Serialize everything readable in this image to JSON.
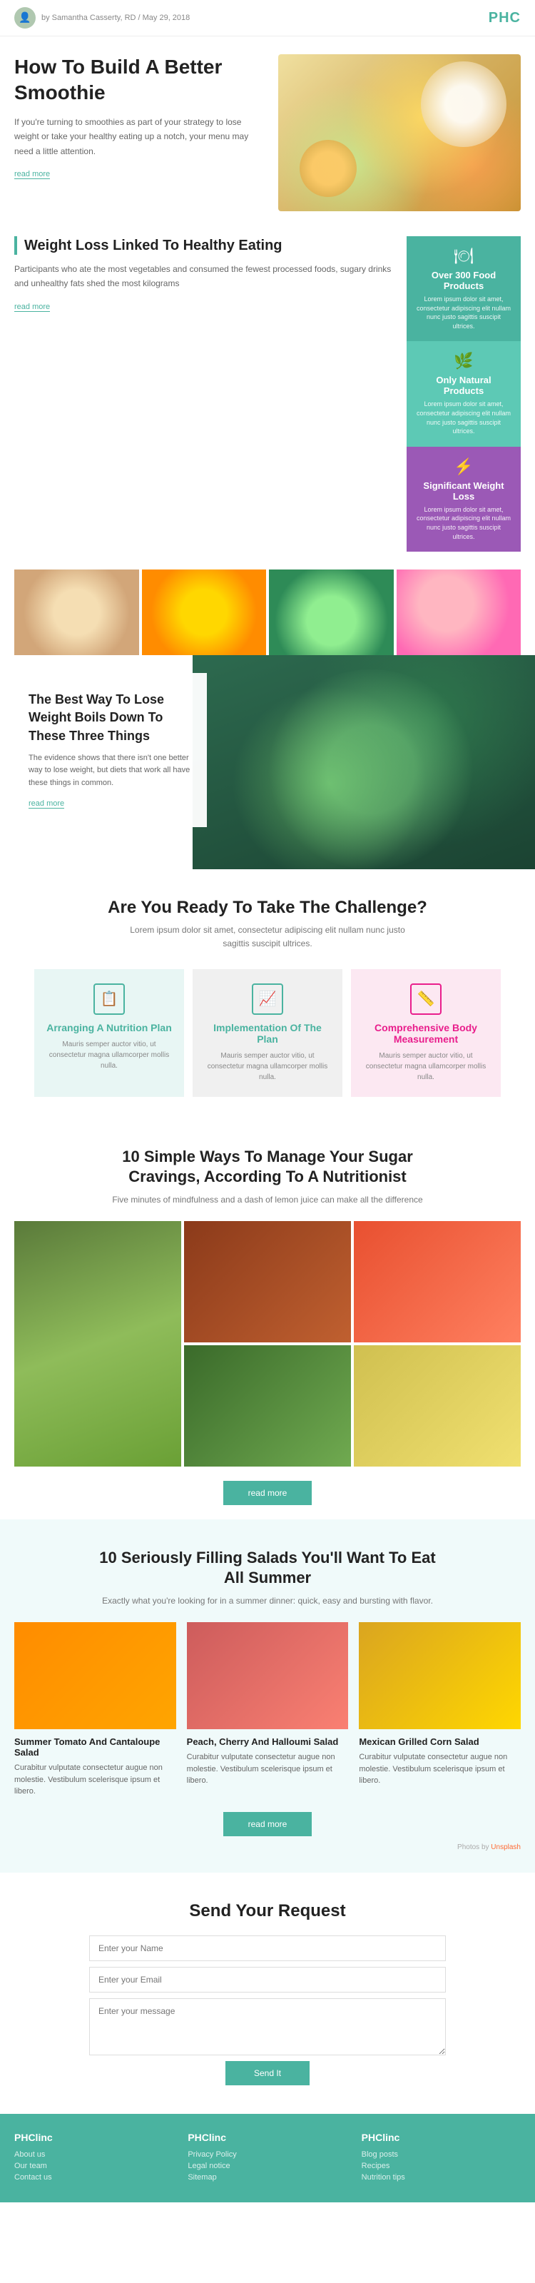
{
  "header": {
    "author": "by Samantha Casserty, RD / May 29, 2018",
    "logo": "PHC"
  },
  "hero": {
    "title": "How To Build A Better Smoothie",
    "description": "If you're turning to smoothies as part of your strategy to lose weight or take your healthy eating up a notch, your menu may need a little attention.",
    "read_more": "read more"
  },
  "weight_section": {
    "title": "Weight Loss Linked To Healthy Eating",
    "description": "Participants who ate the most vegetables and consumed the fewest processed foods, sugary drinks and unhealthy fats shed the most kilograms",
    "read_more": "read more",
    "cards": [
      {
        "icon": "🍽",
        "title": "Over 300 Food Products",
        "text": "Lorem ipsum dolor sit amet, consectetur adipiscing elit nullam nunc justo sagittis suscipit ultrices."
      },
      {
        "icon": "🌿",
        "title": "Only Natural Products",
        "text": "Lorem ipsum dolor sit amet, consectetur adipiscing elit nullam nunc justo sagittis suscipit ultrices."
      },
      {
        "icon": "⚡",
        "title": "Significant Weight Loss",
        "text": "Lorem ipsum dolor sit amet, consectetur adipiscing elit nullam nunc justo sagittis suscipit ultrices."
      }
    ]
  },
  "big_banner": {
    "title": "The Best Way To Lose Weight Boils Down To These Three Things",
    "description": "The evidence shows that there isn't one better way to lose weight, but diets that work all have these things in common.",
    "read_more": "read more"
  },
  "challenge_section": {
    "title": "Are You Ready To Take The Challenge?",
    "description": "Lorem ipsum dolor sit amet, consectetur adipiscing elit nullam nunc justo sagittis suscipit ultrices.",
    "cards": [
      {
        "title": "Arranging A Nutrition Plan",
        "text": "Mauris semper auctor vitio, ut consectetur magna ullamcorper mollis nulla.",
        "color": "blue"
      },
      {
        "title": "Implementation Of The Plan",
        "text": "Mauris semper auctor vitio, ut consectetur magna ullamcorper mollis nulla.",
        "color": "white"
      },
      {
        "title": "Comprehensive Body Measurement",
        "text": "Mauris semper auctor vitio, ut consectetur magna ullamcorper mollis nulla.",
        "color": "pink"
      }
    ]
  },
  "sugar_section": {
    "title": "10 Simple Ways To Manage Your Sugar Cravings, According To A Nutritionist",
    "description": "Five minutes of mindfulness and a dash of lemon juice can make all the difference",
    "read_more": "read more"
  },
  "salads_section": {
    "title": "10 Seriously Filling Salads You'll Want To Eat All Summer",
    "description": "Exactly what you're looking for in a summer dinner: quick, easy and bursting with flavor.",
    "salads": [
      {
        "title": "Summer Tomato And Cantaloupe Salad",
        "text": "Curabitur vulputate consectetur augue non molestie. Vestibulum scelerisque ipsum et libero."
      },
      {
        "title": "Peach, Cherry And Halloumi Salad",
        "text": "Curabitur vulputate consectetur augue non molestie. Vestibulum scelerisque ipsum et libero."
      },
      {
        "title": "Mexican Grilled Corn Salad",
        "text": "Curabitur vulputate consectetur augue non molestie. Vestibulum scelerisque ipsum et libero."
      }
    ],
    "read_more": "read more",
    "photos_credit": "Photos by Unsplash"
  },
  "contact_section": {
    "title": "Send Your Request",
    "name_placeholder": "Enter your Name",
    "email_placeholder": "Enter your Email",
    "message_placeholder": "Enter your message",
    "submit_label": "Send It"
  },
  "footer": {
    "cols": [
      {
        "title": "PHClinc",
        "links": [
          "About us",
          "Our team",
          "Contact us"
        ]
      },
      {
        "title": "PHClinc",
        "links": [
          "Privacy Policy",
          "Legal notice",
          "Sitemap"
        ]
      },
      {
        "title": "PHClinc",
        "links": [
          "Blog posts",
          "Recipes",
          "Nutrition tips"
        ]
      }
    ]
  }
}
